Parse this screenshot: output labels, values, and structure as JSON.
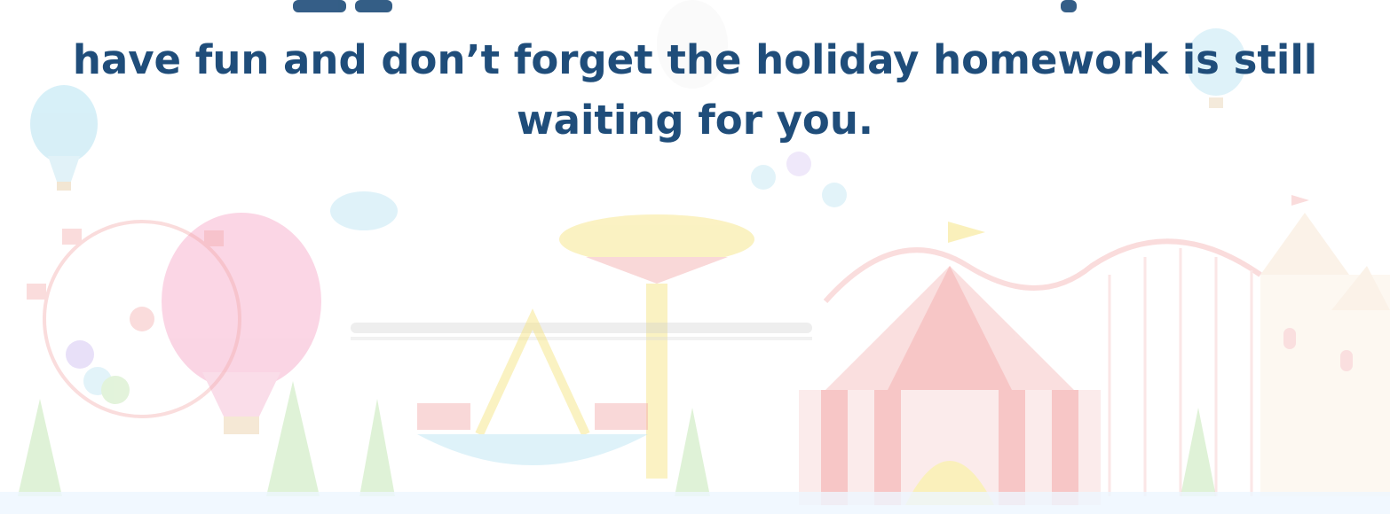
{
  "message": {
    "line_top_partial": "",
    "line_1": "have fun and don’t forget the holiday homework is still",
    "line_2": "waiting for you."
  },
  "colors": {
    "text": "#1f4d7a",
    "balloon_pink": "#f7b4cf",
    "balloon_blue": "#b7e3f2",
    "tent_red": "#f08f8f",
    "ride_yellow": "#f6e37a",
    "tree_green": "#b9e2a6",
    "castle_beige": "#f6e1c8"
  },
  "illustration": {
    "icons": [
      "hot-air-balloon-icon",
      "ferris-wheel-icon",
      "swing-ride-icon",
      "pirate-ship-icon",
      "circus-tent-icon",
      "roller-coaster-icon",
      "castle-icon",
      "tree-icon",
      "train-icon"
    ]
  }
}
